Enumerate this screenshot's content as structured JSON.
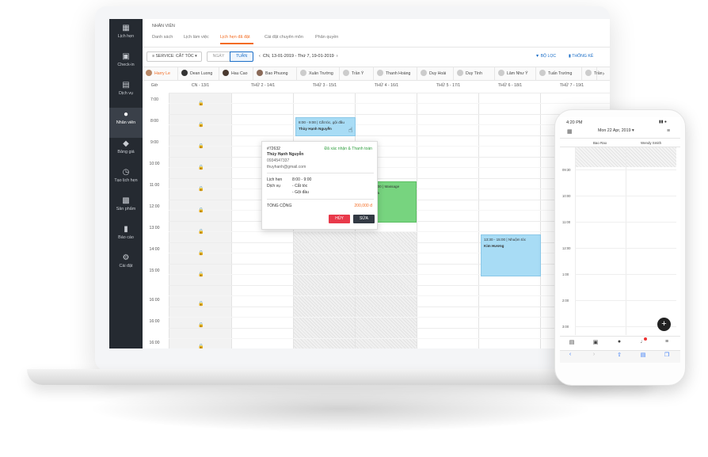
{
  "laptop": {
    "sidebar": {
      "items": [
        {
          "icon": "calendar-icon",
          "label": "Lịch hẹn"
        },
        {
          "icon": "clipboard-icon",
          "label": "Check-in"
        },
        {
          "icon": "book-icon",
          "label": "Dịch vụ"
        },
        {
          "icon": "person-icon",
          "label": "Nhân viên"
        },
        {
          "icon": "tag-icon",
          "label": "Bảng giá"
        },
        {
          "icon": "clock-icon",
          "label": "Tạo lịch hẹn"
        },
        {
          "icon": "gift-icon",
          "label": "Sản phẩm"
        },
        {
          "icon": "bar-chart-icon",
          "label": "Báo cáo"
        },
        {
          "icon": "gear-icon",
          "label": "Cài đặt"
        }
      ],
      "active_index": 3
    },
    "breadcrumb": "NHÂN VIÊN",
    "tabs": [
      "Danh sách",
      "Lịch làm việc",
      "Lịch hẹn đã đặt",
      "Cài đặt chuyên môn",
      "Phân quyền"
    ],
    "active_tab": 2,
    "toolbar": {
      "service_select": "SERVICE: CẮT TÓC",
      "view_day": "NGÀY",
      "view_week": "TUẦN",
      "date_range": "CN, 13-01-2019  -  Thứ 7, 19-01-2019",
      "filter": "BỘ LỌC",
      "stats": "THỐNG KÊ"
    },
    "staff": [
      "Harry Le",
      "Dean Luong",
      "Hau Cao",
      "Bao Phuong",
      "Xuân Trường",
      "Trần Ý",
      "Thanh Hoàng",
      "Duy Hoài",
      "Duy Tính",
      "Lâm Như Ý",
      "Tuấn Trường",
      "Trần"
    ],
    "staff_active": 0,
    "grid": {
      "time_header": "Giờ",
      "days": [
        "CN - 13/1",
        "THỨ 2 - 14/1",
        "THỨ 3 - 15/1",
        "THỨ 4 - 16/1",
        "THỨ 5 - 17/1",
        "THỨ 6 - 18/1",
        "THỨ 7 - 19/1"
      ],
      "times": [
        "7:00",
        "8:00",
        "9:00",
        "10:00",
        "11:00",
        "12:00",
        "13:00",
        "14:00",
        "15:00",
        "16:00",
        "16:00",
        "16:00"
      ]
    },
    "appointments": [
      {
        "time": "8:00 - 9:00 | Cắt tóc, gội đầu",
        "name": "Thùy Hạnh Nguyễn",
        "color": "#a8dcf5"
      },
      {
        "time": "11:00 - 12:00 | Massage",
        "name": "Thanh Nga",
        "color": "#77d47f"
      },
      {
        "time": "13:30 - 15:00 | Nhuộm tóc",
        "name": "Kim Hương",
        "color": "#a8dcf5"
      }
    ],
    "popup": {
      "id": "#72632",
      "status": "Đã xác nhận & Thanh toán",
      "name": "Thúy Hạnh Nguyễn",
      "phone": "0934547337",
      "email": "thuyhanh@gmail.com",
      "label_appt": "Lịch hẹn",
      "appt_time": "8:00 - 9:00",
      "label_service": "Dịch vụ",
      "service_1": "- Cắt tóc",
      "service_2": "- Gội đầu",
      "label_total": "TỔNG CỘNG",
      "total": "200,000 đ",
      "cancel": "HỦY",
      "edit": "SỬA",
      "status_color": "#2e9e3e",
      "total_color": "#f36b21"
    }
  },
  "phone": {
    "time": "4:20 PM",
    "date": "Mon 22 Apr, 2019",
    "columns": [
      "Bao Rao",
      "Wendy Smith"
    ],
    "times": [
      "09:30",
      "10:00",
      "11:00",
      "12:00",
      "1:00",
      "2:00",
      "3:00"
    ],
    "fab": "+"
  }
}
